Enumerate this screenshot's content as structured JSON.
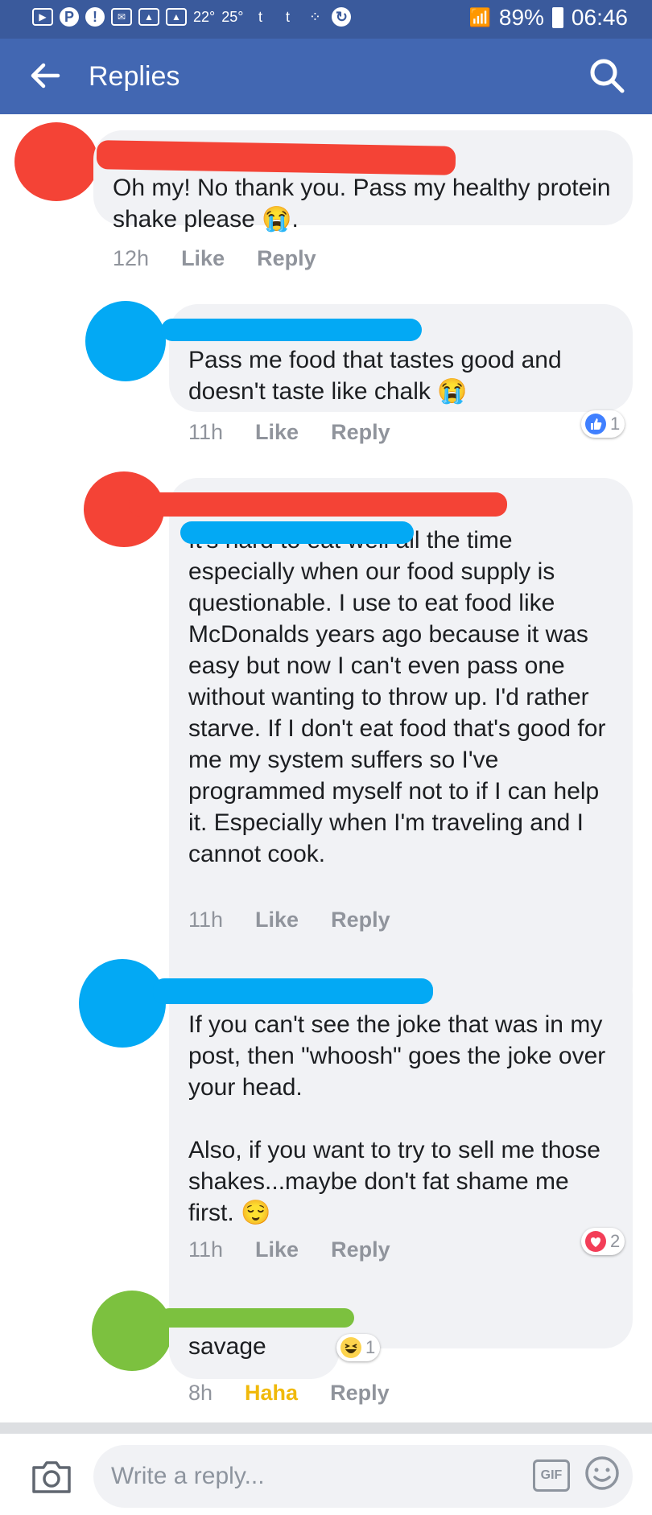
{
  "status_bar": {
    "temp_1": "22°",
    "temp_2": "25°",
    "battery": "89%",
    "time": "06:46"
  },
  "header": {
    "title": "Replies"
  },
  "comments": [
    {
      "text": "Oh my!  No thank you.  Pass my healthy protein shake please 😭.",
      "time": "12h",
      "like": "Like",
      "reply": "Reply"
    },
    {
      "text": "Pass me food that tastes good and doesn't taste like chalk 😭",
      "time": "11h",
      "like": "Like",
      "reply": "Reply",
      "reaction_count": "1"
    },
    {
      "text": "It's hard to eat well all the time especially when our food supply is questionable.   I use to eat food like McDonalds years ago because it was easy but now I can't even pass one without wanting to throw up.  I'd rather starve.   If I don't eat food that's good for me my system suffers so I've programmed myself not to if I can help it.  Especially when I'm traveling and I cannot cook.",
      "time": "11h",
      "like": "Like",
      "reply": "Reply"
    },
    {
      "text_1": "If you can't see the joke that was in my post, then \"whoosh\" goes the joke over your head.",
      "text_2": "Also, if you want to try to sell me those shakes...maybe don't fat shame me first. 😌",
      "time": "11h",
      "like": "Like",
      "reply": "Reply",
      "reaction_count": "2"
    },
    {
      "text": "savage",
      "time": "8h",
      "like": "Haha",
      "reply": "Reply",
      "reaction_count": "1"
    }
  ],
  "composer": {
    "placeholder": "Write a reply...",
    "gif_label": "GIF"
  },
  "colors": {
    "status_bar": "#3a5a9c",
    "app_bar": "#4267b2",
    "bubble": "#f1f2f5",
    "meta_text": "#90949c",
    "haha_active": "#f0b90b",
    "scribble_red": "#f44336",
    "scribble_blue": "#03a9f4",
    "scribble_green": "#7cc13f"
  }
}
